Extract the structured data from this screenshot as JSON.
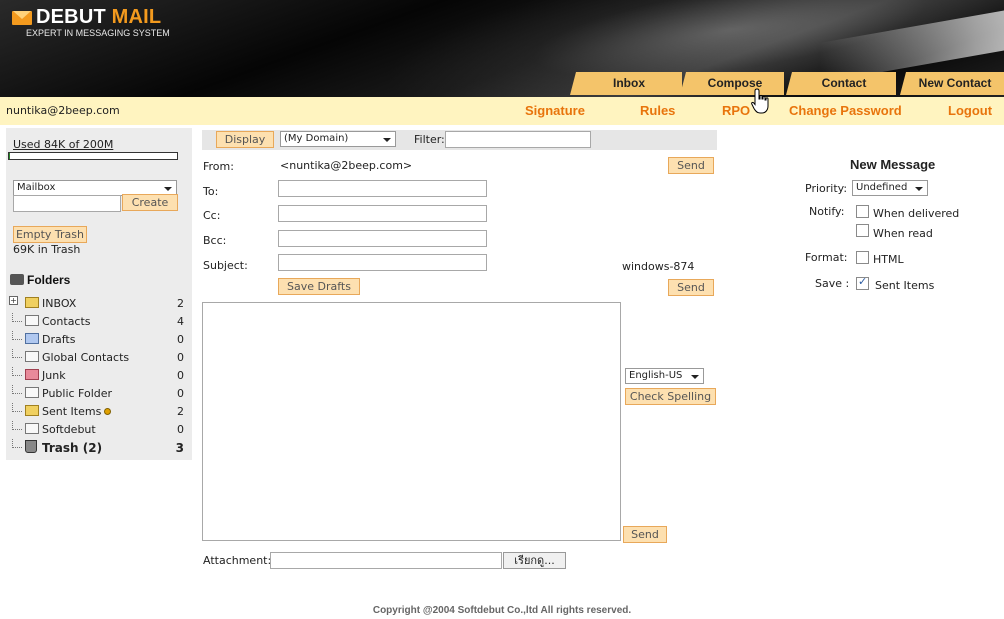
{
  "logo": {
    "brand1": "DEBUT",
    "brand2": "MAIL",
    "tagline": "EXPERT IN MESSAGING SYSTEM"
  },
  "tabs": [
    "Inbox",
    "Compose",
    "Contact",
    "New Contact"
  ],
  "user": {
    "email": "nuntika@2beep.com"
  },
  "user_links": [
    "Signature",
    "Rules",
    "RPO",
    "Change Password",
    "Logout"
  ],
  "sidebar": {
    "quota": "Used 84K of 200M",
    "quota_fill_fraction": 0.0004,
    "mailbox_select": "Mailbox",
    "mailbox_input": "",
    "create_button": "Create",
    "empty_trash_button": "Empty Trash",
    "trash_info": "69K in Trash",
    "folders_title": "Folders",
    "folders": [
      {
        "name": "INBOX",
        "count": "2"
      },
      {
        "name": "Contacts",
        "count": "4"
      },
      {
        "name": "Drafts",
        "count": "0"
      },
      {
        "name": "Global Contacts",
        "count": "0"
      },
      {
        "name": "Junk",
        "count": "0"
      },
      {
        "name": "Public Folder",
        "count": "0"
      },
      {
        "name": "Sent Items",
        "count": "2"
      },
      {
        "name": "Softdebut",
        "count": "0"
      },
      {
        "name": "Trash (2)",
        "count": "3"
      }
    ]
  },
  "compose": {
    "display_button": "Display",
    "domain_select": "(My Domain)",
    "filter_label": "Filter:",
    "filter_value": "",
    "from_label": "From:",
    "from_value": "<nuntika@2beep.com>",
    "to_label": "To:",
    "cc_label": "Cc:",
    "bcc_label": "Bcc:",
    "subject_label": "Subject:",
    "to_value": "",
    "cc_value": "",
    "bcc_value": "",
    "subject_value": "",
    "send_button": "Send",
    "save_drafts_button": "Save Drafts",
    "charset": "windows-874",
    "language_select": "English-US",
    "check_spelling_button": "Check Spelling",
    "attachment_label": "Attachment:",
    "attachment_value": "",
    "browse_button": "เรียกดู..."
  },
  "new_message": {
    "title": "New Message",
    "priority_label": "Priority:",
    "priority_value": "Undefined",
    "notify_label": "Notify:",
    "notify_delivered": "When delivered",
    "notify_read": "When read",
    "format_label": "Format:",
    "format_html": "HTML",
    "save_label": "Save :",
    "save_sent": "Sent Items"
  },
  "footer": "Copyright @2004 Softdebut Co.,ltd All rights reserved.",
  "colors": {
    "accent": "#e8740c",
    "tab": "#f4c46a",
    "userbar": "#fff4c0",
    "button_bg": "#fde0b0"
  }
}
